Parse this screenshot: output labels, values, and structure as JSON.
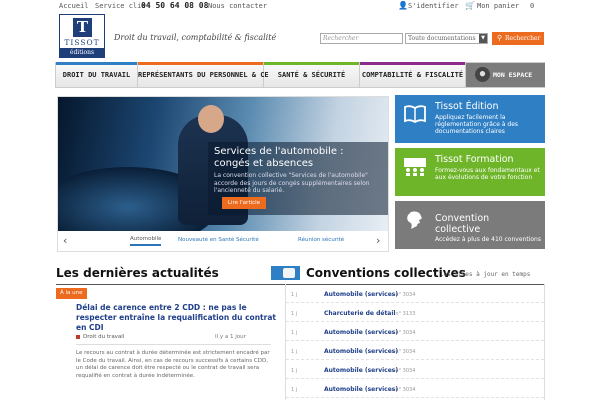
{
  "topbar": {
    "home": "Accueil",
    "service_label": "Service clie",
    "phone": "04 50 64 08 08",
    "contact": "Nous contacter",
    "login": "S'identifier",
    "cart": "Mon panier",
    "cart_count": "0"
  },
  "header": {
    "logo_mark": "T",
    "logo_name": "TISSOT",
    "logo_sub": "éditions",
    "tagline": "Droit du travail, comptabilité & fiscalité",
    "search_placeholder": "Rechercher",
    "search_scope": "Toute documentations",
    "search_button": "Rechercher"
  },
  "nav": {
    "items": [
      {
        "label": "DROIT DU TRAVAIL",
        "color": "#2f7fc4"
      },
      {
        "label": "REPRÉSENTANTS DU PERSONNEL & CE",
        "color": "#ec6b1e"
      },
      {
        "label": "SANTÉ & SÉCURITÉ",
        "color": "#6fb52a"
      },
      {
        "label": "COMPTABILITÉ & FISCALITÉ",
        "color": "#8b2d8b"
      }
    ],
    "my_space": "MON ESPACE"
  },
  "hero": {
    "title": "Services de l'automobile : congés et absences",
    "text": "La convention collective \"Services de l'automobile\" accorde des jours de congés supplémentaires selon l'ancienneté du salarié.",
    "button": "Lire l'article",
    "tabs": [
      "Automobile",
      "Nouveauté en Santé Sécurité",
      "Réunion sécurité"
    ]
  },
  "promos": [
    {
      "title": "Tissot Édition",
      "desc": "Appliquez facilement la réglementation grâce à des documentations claires",
      "color": "#2f7fc4",
      "icon": "book-icon"
    },
    {
      "title": "Tissot Formation",
      "desc": "Formez-vous aux fondamentaux et aux évolutions de votre fonction",
      "color": "#6fb52a",
      "icon": "classroom-icon"
    },
    {
      "title": "Convention collective",
      "desc": "Accédez à plus de 410 conventions",
      "color": "#7b7b7b",
      "icon": "marianne-icon"
    }
  ],
  "news": {
    "section_title": "Les dernières actualités",
    "badge": "À la une",
    "title": "Délai de carence entre 2 CDD : ne pas le respecter entraîne la requalification du contrat en CDI",
    "category": "Droit du travail",
    "date": "Il y a 1 jour",
    "body": "Le recours au contrat à durée déterminée est strictement encadré par le Code du travail. Ainsi, en cas de recours successifs à certains CDD, un délai de carence doit être respecté ou le contrat de travail sera requalifié en contrat à durée indéterminée."
  },
  "conventions": {
    "section_title": "Conventions collectives",
    "live": "les mises à jour en temps",
    "rows": [
      {
        "day": "1 j",
        "name": "Automobile (services)",
        "ref": "- n° 3034"
      },
      {
        "day": "1 j",
        "name": "Charcuterie de détail",
        "ref": "- n° 3133"
      },
      {
        "day": "1 j",
        "name": "Automobile (services)",
        "ref": "- n° 3034"
      },
      {
        "day": "1 j",
        "name": "Automobile (services)",
        "ref": "- n° 3034"
      },
      {
        "day": "1 j",
        "name": "Automobile (services)",
        "ref": "- n° 3034"
      },
      {
        "day": "1 j",
        "name": "Automobile (services)",
        "ref": "- n° 3034"
      }
    ]
  }
}
